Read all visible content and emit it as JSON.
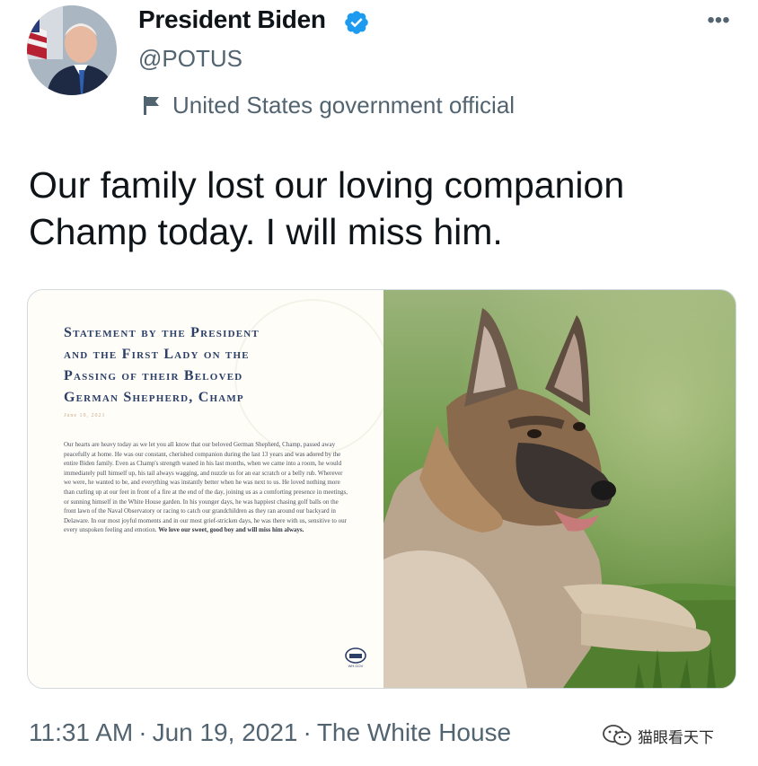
{
  "tweet": {
    "author_name": "President Biden",
    "handle": "@POTUS",
    "account_label": "United States government official",
    "text": "Our family lost our loving companion Champ today. I will miss him.",
    "icons": {
      "avatar": "avatar-photo",
      "verified": "verified-badge-icon",
      "more": "more-options-icon",
      "label": "flag-icon"
    },
    "colors": {
      "verified_blue": "#1d9bf0",
      "secondary_text": "#536471",
      "primary_text": "#0f1419",
      "statement_navy": "#2c3f66"
    }
  },
  "media": {
    "statement": {
      "title_lines": [
        "Statement by the President",
        "and the First Lady on the",
        "Passing of their Beloved",
        "German Shepherd, Champ"
      ],
      "date": "June 19, 2021",
      "body": "Our hearts are heavy today as we let you all know that our beloved German Shepherd, Champ, passed away peacefully at home. He was our constant, cherished companion during the last 13 years and was adored by the entire Biden family. Even as Champ's strength waned in his last months, when we came into a room, he would immediately pull himself up, his tail always wagging, and nuzzle us for an ear scratch or a belly rub. Wherever we were, he wanted to be, and everything was instantly better when he was next to us. He loved nothing more than curling up at our feet in front of a fire at the end of the day, joining us as a comforting presence in meetings, or sunning himself in the White House garden. In his younger days, he was happiest chasing golf balls on the front lawn of the Naval Observatory or racing to catch our grandchildren as they ran around our backyard in Delaware. In our most joyful moments and in our most grief-stricken days, he was there with us, sensitive to our every unspoken feeling and emotion.",
      "closing": "We love our sweet, good boy and will miss him always.",
      "seal_caption": "WH.GOV"
    },
    "photo": {
      "subject": "german-shepherd-dog-photo"
    }
  },
  "meta": {
    "time": "11:31 AM",
    "date": "Jun 19, 2021",
    "separator": "·",
    "source": "The White House"
  },
  "watermark": {
    "text": "猫眼看天下",
    "icon": "wechat-logo-icon"
  }
}
